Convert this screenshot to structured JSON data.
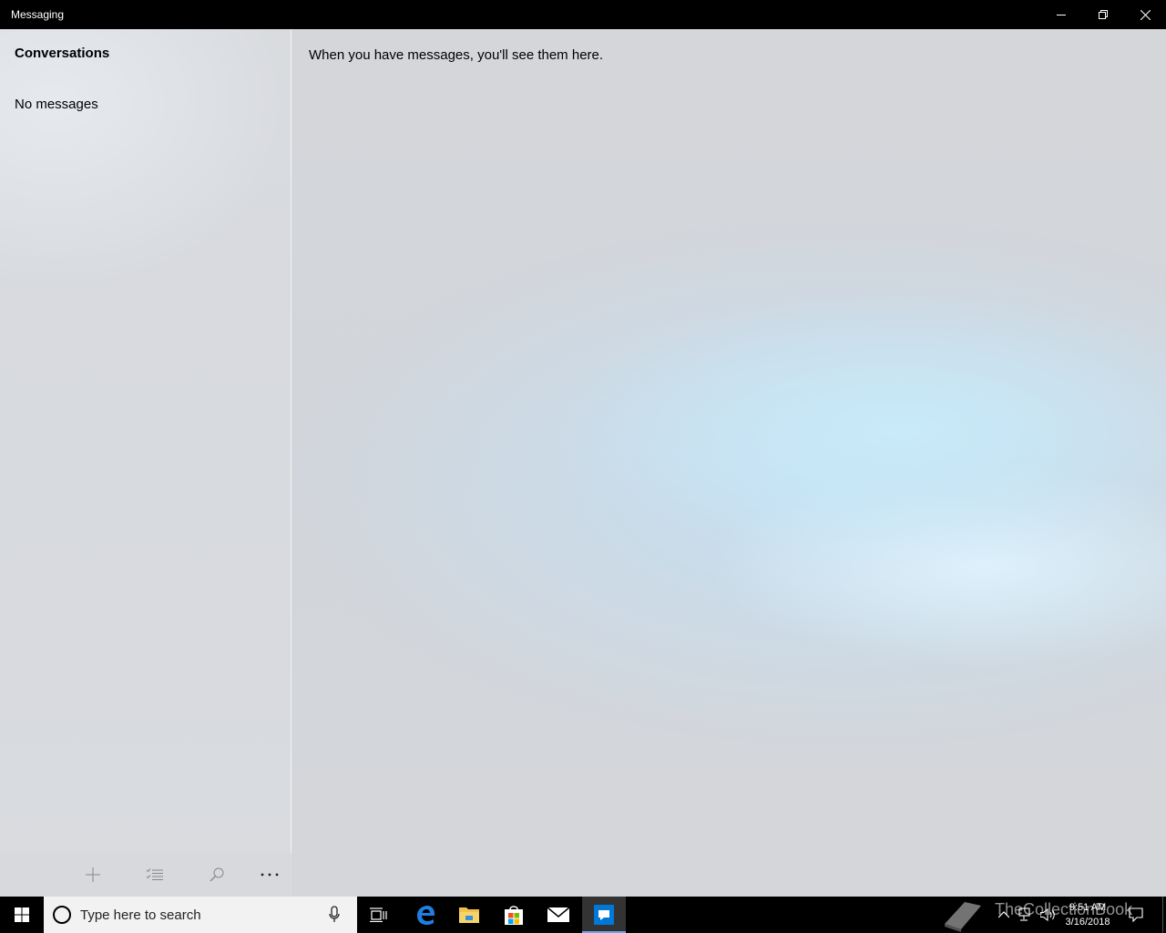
{
  "window": {
    "title": "Messaging"
  },
  "sidebar": {
    "title": "Conversations",
    "empty_text": "No messages",
    "commands": [
      {
        "name": "new-message",
        "icon": "plus-icon"
      },
      {
        "name": "select",
        "icon": "select-list-icon"
      },
      {
        "name": "search",
        "icon": "search-icon"
      },
      {
        "name": "more",
        "icon": "more-icon"
      }
    ]
  },
  "main": {
    "empty_text": "When you have messages, you'll see them here."
  },
  "taskbar": {
    "search_placeholder": "Type here to search",
    "apps": [
      "task-view",
      "edge",
      "file-explorer",
      "store",
      "mail",
      "messaging"
    ],
    "active_app": "messaging",
    "clock_time": "9:51 AM",
    "clock_date": "3/16/2018",
    "watermark": "TheCollectionBook",
    "accent_color": "#0078d7"
  }
}
